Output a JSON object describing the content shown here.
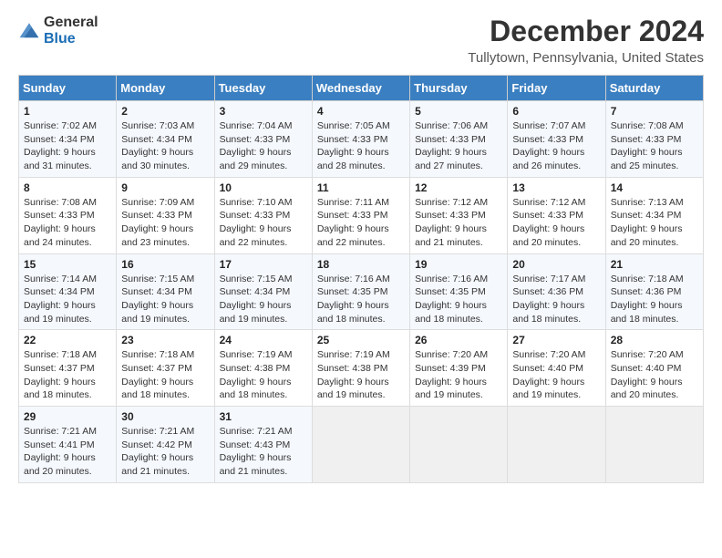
{
  "header": {
    "logo_general": "General",
    "logo_blue": "Blue",
    "month_title": "December 2024",
    "location": "Tullytown, Pennsylvania, United States"
  },
  "days_of_week": [
    "Sunday",
    "Monday",
    "Tuesday",
    "Wednesday",
    "Thursday",
    "Friday",
    "Saturday"
  ],
  "weeks": [
    [
      {
        "day": "1",
        "sunrise": "7:02 AM",
        "sunset": "4:34 PM",
        "daylight_hours": "9",
        "daylight_minutes": "31"
      },
      {
        "day": "2",
        "sunrise": "7:03 AM",
        "sunset": "4:34 PM",
        "daylight_hours": "9",
        "daylight_minutes": "30"
      },
      {
        "day": "3",
        "sunrise": "7:04 AM",
        "sunset": "4:33 PM",
        "daylight_hours": "9",
        "daylight_minutes": "29"
      },
      {
        "day": "4",
        "sunrise": "7:05 AM",
        "sunset": "4:33 PM",
        "daylight_hours": "9",
        "daylight_minutes": "28"
      },
      {
        "day": "5",
        "sunrise": "7:06 AM",
        "sunset": "4:33 PM",
        "daylight_hours": "9",
        "daylight_minutes": "27"
      },
      {
        "day": "6",
        "sunrise": "7:07 AM",
        "sunset": "4:33 PM",
        "daylight_hours": "9",
        "daylight_minutes": "26"
      },
      {
        "day": "7",
        "sunrise": "7:08 AM",
        "sunset": "4:33 PM",
        "daylight_hours": "9",
        "daylight_minutes": "25"
      }
    ],
    [
      {
        "day": "8",
        "sunrise": "7:08 AM",
        "sunset": "4:33 PM",
        "daylight_hours": "9",
        "daylight_minutes": "24"
      },
      {
        "day": "9",
        "sunrise": "7:09 AM",
        "sunset": "4:33 PM",
        "daylight_hours": "9",
        "daylight_minutes": "23"
      },
      {
        "day": "10",
        "sunrise": "7:10 AM",
        "sunset": "4:33 PM",
        "daylight_hours": "9",
        "daylight_minutes": "22"
      },
      {
        "day": "11",
        "sunrise": "7:11 AM",
        "sunset": "4:33 PM",
        "daylight_hours": "9",
        "daylight_minutes": "22"
      },
      {
        "day": "12",
        "sunrise": "7:12 AM",
        "sunset": "4:33 PM",
        "daylight_hours": "9",
        "daylight_minutes": "21"
      },
      {
        "day": "13",
        "sunrise": "7:12 AM",
        "sunset": "4:33 PM",
        "daylight_hours": "9",
        "daylight_minutes": "20"
      },
      {
        "day": "14",
        "sunrise": "7:13 AM",
        "sunset": "4:34 PM",
        "daylight_hours": "9",
        "daylight_minutes": "20"
      }
    ],
    [
      {
        "day": "15",
        "sunrise": "7:14 AM",
        "sunset": "4:34 PM",
        "daylight_hours": "9",
        "daylight_minutes": "19"
      },
      {
        "day": "16",
        "sunrise": "7:15 AM",
        "sunset": "4:34 PM",
        "daylight_hours": "9",
        "daylight_minutes": "19"
      },
      {
        "day": "17",
        "sunrise": "7:15 AM",
        "sunset": "4:34 PM",
        "daylight_hours": "9",
        "daylight_minutes": "19"
      },
      {
        "day": "18",
        "sunrise": "7:16 AM",
        "sunset": "4:35 PM",
        "daylight_hours": "9",
        "daylight_minutes": "18"
      },
      {
        "day": "19",
        "sunrise": "7:16 AM",
        "sunset": "4:35 PM",
        "daylight_hours": "9",
        "daylight_minutes": "18"
      },
      {
        "day": "20",
        "sunrise": "7:17 AM",
        "sunset": "4:36 PM",
        "daylight_hours": "9",
        "daylight_minutes": "18"
      },
      {
        "day": "21",
        "sunrise": "7:18 AM",
        "sunset": "4:36 PM",
        "daylight_hours": "9",
        "daylight_minutes": "18"
      }
    ],
    [
      {
        "day": "22",
        "sunrise": "7:18 AM",
        "sunset": "4:37 PM",
        "daylight_hours": "9",
        "daylight_minutes": "18"
      },
      {
        "day": "23",
        "sunrise": "7:18 AM",
        "sunset": "4:37 PM",
        "daylight_hours": "9",
        "daylight_minutes": "18"
      },
      {
        "day": "24",
        "sunrise": "7:19 AM",
        "sunset": "4:38 PM",
        "daylight_hours": "9",
        "daylight_minutes": "18"
      },
      {
        "day": "25",
        "sunrise": "7:19 AM",
        "sunset": "4:38 PM",
        "daylight_hours": "9",
        "daylight_minutes": "19"
      },
      {
        "day": "26",
        "sunrise": "7:20 AM",
        "sunset": "4:39 PM",
        "daylight_hours": "9",
        "daylight_minutes": "19"
      },
      {
        "day": "27",
        "sunrise": "7:20 AM",
        "sunset": "4:40 PM",
        "daylight_hours": "9",
        "daylight_minutes": "19"
      },
      {
        "day": "28",
        "sunrise": "7:20 AM",
        "sunset": "4:40 PM",
        "daylight_hours": "9",
        "daylight_minutes": "20"
      }
    ],
    [
      {
        "day": "29",
        "sunrise": "7:21 AM",
        "sunset": "4:41 PM",
        "daylight_hours": "9",
        "daylight_minutes": "20"
      },
      {
        "day": "30",
        "sunrise": "7:21 AM",
        "sunset": "4:42 PM",
        "daylight_hours": "9",
        "daylight_minutes": "21"
      },
      {
        "day": "31",
        "sunrise": "7:21 AM",
        "sunset": "4:43 PM",
        "daylight_hours": "9",
        "daylight_minutes": "21"
      },
      null,
      null,
      null,
      null
    ]
  ],
  "labels": {
    "sunrise": "Sunrise:",
    "sunset": "Sunset:",
    "daylight": "Daylight:",
    "hours_suffix": "hours",
    "and": "and",
    "minutes_suffix": "minutes."
  }
}
